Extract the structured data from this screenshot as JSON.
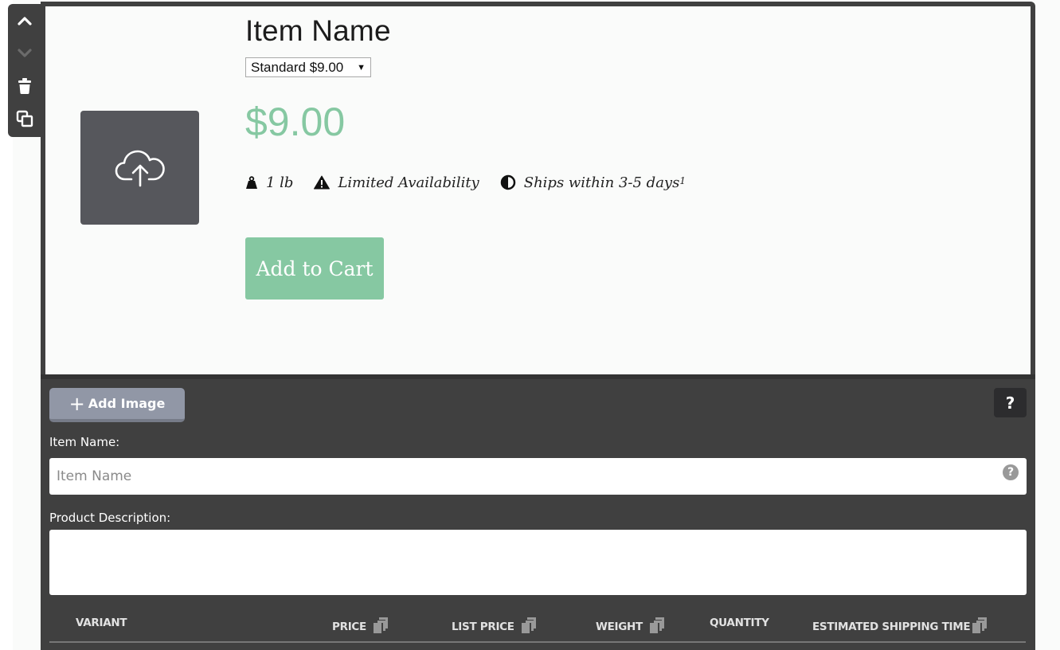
{
  "toolbar": {
    "move_up_icon": "chevron-up-icon",
    "move_down_icon": "chevron-down-icon",
    "delete_icon": "trash-icon",
    "duplicate_icon": "duplicate-icon"
  },
  "preview": {
    "image_icon": "cloud-upload-icon",
    "title": "Item Name",
    "variant_selected": "Standard $9.00",
    "variant_arrow": "▼",
    "price": "$9.00",
    "meta": {
      "weight": "1 lb",
      "availability": "Limited Availability",
      "shipping": "Ships within 3-5 days",
      "shipping_footnote": "1"
    },
    "add_to_cart_label": "Add to Cart"
  },
  "editor": {
    "add_image_plus": "+",
    "add_image_label": "Add Image",
    "help_label": "?",
    "item_name_label": "Item Name:",
    "item_name_value": "",
    "item_name_placeholder": "Item Name",
    "item_name_help": "?",
    "description_label": "Product Description:",
    "description_value": "",
    "variant_table": {
      "columns": [
        {
          "label": "VARIANT",
          "copyable": false
        },
        {
          "label": "PRICE",
          "copyable": true
        },
        {
          "label": "LIST PRICE",
          "copyable": true
        },
        {
          "label": "WEIGHT",
          "copyable": true
        },
        {
          "label": "QUANTITY",
          "copyable": false
        },
        {
          "label": "ESTIMATED SHIPPING TIME",
          "copyable": true
        }
      ]
    }
  },
  "colors": {
    "accent_green": "#86c8a2",
    "panel_dark": "#404040",
    "add_image_button": "#9197a6",
    "image_placeholder": "#56575c"
  }
}
